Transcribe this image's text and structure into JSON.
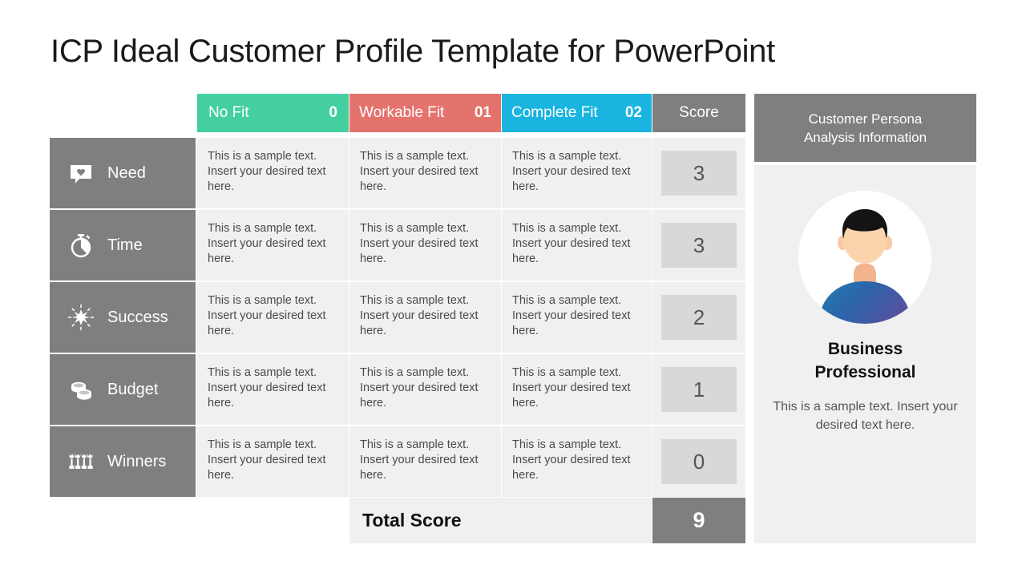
{
  "title": "ICP Ideal Customer Profile Template for PowerPoint",
  "colors": {
    "no_fit": "#44cfa1",
    "workable_fit": "#e4736e",
    "complete_fit": "#19b4df",
    "gray": "#7f7f7f",
    "cell_bg": "#f0f0f0",
    "chip_bg": "#d8d8d8"
  },
  "table": {
    "headers": [
      {
        "label": "No Fit",
        "number": "0"
      },
      {
        "label": "Workable  Fit",
        "number": "01"
      },
      {
        "label": "Complete Fit",
        "number": "02"
      }
    ],
    "score_header": "Score",
    "sample_text": "This is a sample text. Insert your desired text here.",
    "rows": [
      {
        "criterion": "Need",
        "icon": "speech-bubble-heart-icon",
        "no_fit": "This is a sample text. Insert your desired text here.",
        "workable_fit": "This is a sample text. Insert your desired text here.",
        "complete_fit": "This is a sample text. Insert your desired text here.",
        "score": "3"
      },
      {
        "criterion": "Time",
        "icon": "stopwatch-icon",
        "no_fit": "This is a sample text. Insert your desired text here.",
        "workable_fit": "This is a sample text. Insert your desired text here.",
        "complete_fit": "This is a sample text. Insert your desired text here.",
        "score": "3"
      },
      {
        "criterion": "Success",
        "icon": "starburst-icon",
        "no_fit": "This is a sample text. Insert your desired text here.",
        "workable_fit": "This is a sample text. Insert your desired text here.",
        "complete_fit": "This is a sample text. Insert your desired text here.",
        "score": "2"
      },
      {
        "criterion": "Budget",
        "icon": "coins-icon",
        "no_fit": "This is a sample text. Insert your desired text here.",
        "workable_fit": "This is a sample text. Insert your desired text here.",
        "complete_fit": "This is a sample text. Insert your desired text here.",
        "score": "1"
      },
      {
        "criterion": "Winners",
        "icon": "crowd-icon",
        "no_fit": "This is a sample text. Insert your desired text here.",
        "workable_fit": "This is a sample text. Insert your desired text here.",
        "complete_fit": "This is a sample text. Insert your desired text here.",
        "score": "0"
      }
    ],
    "total_label": "Total Score",
    "total_value": "9"
  },
  "persona": {
    "header": "Customer Persona\nAnalysis Information",
    "avatar_icon": "male-avatar-icon",
    "name": "Business\nProfessional",
    "description": "This is a sample text. Insert your desired text here."
  }
}
